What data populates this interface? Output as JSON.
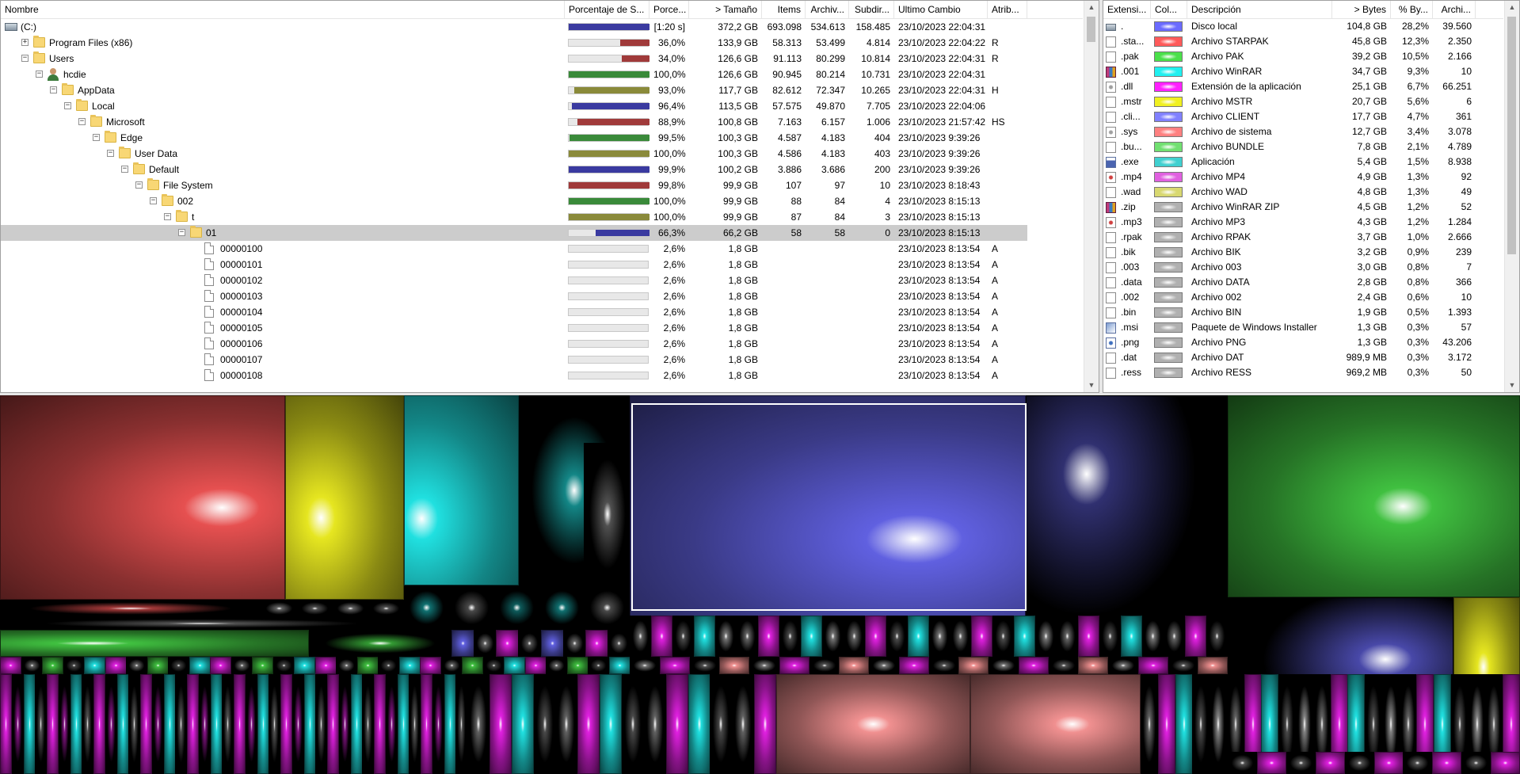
{
  "tree": {
    "columns": [
      "Nombre",
      "Porcentaje de S...",
      "Porce...",
      "> Tamaño",
      "Items",
      "Archiv...",
      "Subdir...",
      "Ultimo Cambio",
      "Atrib..."
    ],
    "rows": [
      {
        "level": 0,
        "icon": "drive",
        "expander": "",
        "name": "(C:)",
        "bar": 1.0,
        "bar_color": "#3a3aa0",
        "pct": "[1:20 s]",
        "size": "372,2 GB",
        "items": "693.098",
        "files": "534.613",
        "subdirs": "158.485",
        "modified": "23/10/2023  22:04:31",
        "attr": ""
      },
      {
        "level": 1,
        "icon": "folder",
        "expander": "+",
        "name": "Program Files (x86)",
        "bar": 0.36,
        "bar_color": "#a03a3a",
        "pct": "36,0%",
        "size": "133,9 GB",
        "items": "58.313",
        "files": "53.499",
        "subdirs": "4.814",
        "modified": "23/10/2023  22:04:22",
        "attr": "R"
      },
      {
        "level": 1,
        "icon": "folder",
        "expander": "−",
        "name": "Users",
        "bar": 0.34,
        "bar_color": "#a03a3a",
        "pct": "34,0%",
        "size": "126,6 GB",
        "items": "91.113",
        "files": "80.299",
        "subdirs": "10.814",
        "modified": "23/10/2023  22:04:31",
        "attr": "R"
      },
      {
        "level": 2,
        "icon": "user",
        "expander": "−",
        "name": "hcdie",
        "bar": 1.0,
        "bar_color": "#3a8a3a",
        "pct": "100,0%",
        "size": "126,6 GB",
        "items": "90.945",
        "files": "80.214",
        "subdirs": "10.731",
        "modified": "23/10/2023  22:04:31",
        "attr": ""
      },
      {
        "level": 3,
        "icon": "folder",
        "expander": "−",
        "name": "AppData",
        "bar": 0.93,
        "bar_color": "#8a8a3a",
        "pct": "93,0%",
        "size": "117,7 GB",
        "items": "82.612",
        "files": "72.347",
        "subdirs": "10.265",
        "modified": "23/10/2023  22:04:31",
        "attr": "H"
      },
      {
        "level": 4,
        "icon": "folder",
        "expander": "−",
        "name": "Local",
        "bar": 0.964,
        "bar_color": "#3a3aa0",
        "pct": "96,4%",
        "size": "113,5 GB",
        "items": "57.575",
        "files": "49.870",
        "subdirs": "7.705",
        "modified": "23/10/2023  22:04:06",
        "attr": ""
      },
      {
        "level": 5,
        "icon": "folder",
        "expander": "−",
        "name": "Microsoft",
        "bar": 0.889,
        "bar_color": "#a03a3a",
        "pct": "88,9%",
        "size": "100,8 GB",
        "items": "7.163",
        "files": "6.157",
        "subdirs": "1.006",
        "modified": "23/10/2023  21:57:42",
        "attr": "HS"
      },
      {
        "level": 6,
        "icon": "folder",
        "expander": "−",
        "name": "Edge",
        "bar": 0.995,
        "bar_color": "#3a8a3a",
        "pct": "99,5%",
        "size": "100,3 GB",
        "items": "4.587",
        "files": "4.183",
        "subdirs": "404",
        "modified": "23/10/2023  9:39:26",
        "attr": ""
      },
      {
        "level": 7,
        "icon": "folder",
        "expander": "−",
        "name": "User Data",
        "bar": 1.0,
        "bar_color": "#8a8a3a",
        "pct": "100,0%",
        "size": "100,3 GB",
        "items": "4.586",
        "files": "4.183",
        "subdirs": "403",
        "modified": "23/10/2023  9:39:26",
        "attr": ""
      },
      {
        "level": 8,
        "icon": "folder",
        "expander": "−",
        "name": "Default",
        "bar": 0.999,
        "bar_color": "#3a3aa0",
        "pct": "99,9%",
        "size": "100,2 GB",
        "items": "3.886",
        "files": "3.686",
        "subdirs": "200",
        "modified": "23/10/2023  9:39:26",
        "attr": ""
      },
      {
        "level": 9,
        "icon": "folder",
        "expander": "−",
        "name": "File System",
        "bar": 0.998,
        "bar_color": "#a03a3a",
        "pct": "99,8%",
        "size": "99,9 GB",
        "items": "107",
        "files": "97",
        "subdirs": "10",
        "modified": "23/10/2023  8:18:43",
        "attr": ""
      },
      {
        "level": 10,
        "icon": "folder",
        "expander": "−",
        "name": "002",
        "bar": 1.0,
        "bar_color": "#3a8a3a",
        "pct": "100,0%",
        "size": "99,9 GB",
        "items": "88",
        "files": "84",
        "subdirs": "4",
        "modified": "23/10/2023  8:15:13",
        "attr": ""
      },
      {
        "level": 11,
        "icon": "folder",
        "expander": "−",
        "name": "t",
        "bar": 1.0,
        "bar_color": "#8a8a3a",
        "pct": "100,0%",
        "size": "99,9 GB",
        "items": "87",
        "files": "84",
        "subdirs": "3",
        "modified": "23/10/2023  8:15:13",
        "attr": ""
      },
      {
        "level": 12,
        "icon": "folder",
        "expander": "−",
        "name": "01",
        "bar": 0.663,
        "bar_color": "#3a3aa0",
        "pct": "66,3%",
        "size": "66,2 GB",
        "items": "58",
        "files": "58",
        "subdirs": "0",
        "modified": "23/10/2023  8:15:13",
        "attr": "",
        "selected": true
      },
      {
        "level": 13,
        "icon": "file",
        "expander": "",
        "name": "00000100",
        "bar": 0.026,
        "bar_color": "#c0c0c0",
        "pct": "2,6%",
        "size": "1,8 GB",
        "items": "",
        "files": "",
        "subdirs": "",
        "modified": "23/10/2023  8:13:54",
        "attr": "A"
      },
      {
        "level": 13,
        "icon": "file",
        "expander": "",
        "name": "00000101",
        "bar": 0.026,
        "bar_color": "#c0c0c0",
        "pct": "2,6%",
        "size": "1,8 GB",
        "items": "",
        "files": "",
        "subdirs": "",
        "modified": "23/10/2023  8:13:54",
        "attr": "A"
      },
      {
        "level": 13,
        "icon": "file",
        "expander": "",
        "name": "00000102",
        "bar": 0.026,
        "bar_color": "#c0c0c0",
        "pct": "2,6%",
        "size": "1,8 GB",
        "items": "",
        "files": "",
        "subdirs": "",
        "modified": "23/10/2023  8:13:54",
        "attr": "A"
      },
      {
        "level": 13,
        "icon": "file",
        "expander": "",
        "name": "00000103",
        "bar": 0.026,
        "bar_color": "#c0c0c0",
        "pct": "2,6%",
        "size": "1,8 GB",
        "items": "",
        "files": "",
        "subdirs": "",
        "modified": "23/10/2023  8:13:54",
        "attr": "A"
      },
      {
        "level": 13,
        "icon": "file",
        "expander": "",
        "name": "00000104",
        "bar": 0.026,
        "bar_color": "#c0c0c0",
        "pct": "2,6%",
        "size": "1,8 GB",
        "items": "",
        "files": "",
        "subdirs": "",
        "modified": "23/10/2023  8:13:54",
        "attr": "A"
      },
      {
        "level": 13,
        "icon": "file",
        "expander": "",
        "name": "00000105",
        "bar": 0.026,
        "bar_color": "#c0c0c0",
        "pct": "2,6%",
        "size": "1,8 GB",
        "items": "",
        "files": "",
        "subdirs": "",
        "modified": "23/10/2023  8:13:54",
        "attr": "A"
      },
      {
        "level": 13,
        "icon": "file",
        "expander": "",
        "name": "00000106",
        "bar": 0.026,
        "bar_color": "#c0c0c0",
        "pct": "2,6%",
        "size": "1,8 GB",
        "items": "",
        "files": "",
        "subdirs": "",
        "modified": "23/10/2023  8:13:54",
        "attr": "A"
      },
      {
        "level": 13,
        "icon": "file",
        "expander": "",
        "name": "00000107",
        "bar": 0.026,
        "bar_color": "#c0c0c0",
        "pct": "2,6%",
        "size": "1,8 GB",
        "items": "",
        "files": "",
        "subdirs": "",
        "modified": "23/10/2023  8:13:54",
        "attr": "A"
      },
      {
        "level": 13,
        "icon": "file",
        "expander": "",
        "name": "00000108",
        "bar": 0.026,
        "bar_color": "#c0c0c0",
        "pct": "2,6%",
        "size": "1,8 GB",
        "items": "",
        "files": "",
        "subdirs": "",
        "modified": "23/10/2023  8:13:54",
        "attr": "A"
      }
    ]
  },
  "extensions": {
    "columns": [
      "Extensi...",
      "Col...",
      "Descripción",
      "> Bytes",
      "% By...",
      "Archi..."
    ],
    "rows": [
      {
        "icon": "drive",
        "ext": ".",
        "color": "#6a6aff",
        "desc": "Disco local",
        "bytes": "104,8 GB",
        "pct": "28,2%",
        "files": "39.560"
      },
      {
        "icon": "doc",
        "ext": ".sta...",
        "color": "#ff5a5a",
        "desc": "Archivo STARPAK",
        "bytes": "45,8 GB",
        "pct": "12,3%",
        "files": "2.350"
      },
      {
        "icon": "doc",
        "ext": ".pak",
        "color": "#4ae04a",
        "desc": "Archivo PAK",
        "bytes": "39,2 GB",
        "pct": "10,5%",
        "files": "2.166"
      },
      {
        "icon": "winrar",
        "ext": ".001",
        "color": "#20f0f0",
        "desc": "Archivo WinRAR",
        "bytes": "34,7 GB",
        "pct": "9,3%",
        "files": "10"
      },
      {
        "icon": "gear",
        "ext": ".dll",
        "color": "#ff20ff",
        "desc": "Extensión de la aplicación",
        "bytes": "25,1 GB",
        "pct": "6,7%",
        "files": "66.251"
      },
      {
        "icon": "doc",
        "ext": ".mstr",
        "color": "#f0f020",
        "desc": "Archivo MSTR",
        "bytes": "20,7 GB",
        "pct": "5,6%",
        "files": "6"
      },
      {
        "icon": "doc",
        "ext": ".cli...",
        "color": "#8080ff",
        "desc": "Archivo CLIENT",
        "bytes": "17,7 GB",
        "pct": "4,7%",
        "files": "361"
      },
      {
        "icon": "gear",
        "ext": ".sys",
        "color": "#ff8080",
        "desc": "Archivo de sistema",
        "bytes": "12,7 GB",
        "pct": "3,4%",
        "files": "3.078"
      },
      {
        "icon": "doc",
        "ext": ".bu...",
        "color": "#70e070",
        "desc": "Archivo BUNDLE",
        "bytes": "7,8 GB",
        "pct": "2,1%",
        "files": "4.789"
      },
      {
        "icon": "app",
        "ext": ".exe",
        "color": "#40d0d0",
        "desc": "Aplicación",
        "bytes": "5,4 GB",
        "pct": "1,5%",
        "files": "8.938"
      },
      {
        "icon": "media",
        "ext": ".mp4",
        "color": "#e060e0",
        "desc": "Archivo MP4",
        "bytes": "4,9 GB",
        "pct": "1,3%",
        "files": "92"
      },
      {
        "icon": "doc",
        "ext": ".wad",
        "color": "#d8d870",
        "desc": "Archivo WAD",
        "bytes": "4,8 GB",
        "pct": "1,3%",
        "files": "49"
      },
      {
        "icon": "winrar",
        "ext": ".zip",
        "color": "#b0b0b0",
        "desc": "Archivo WinRAR ZIP",
        "bytes": "4,5 GB",
        "pct": "1,2%",
        "files": "52"
      },
      {
        "icon": "media",
        "ext": ".mp3",
        "color": "#b0b0b0",
        "desc": "Archivo MP3",
        "bytes": "4,3 GB",
        "pct": "1,2%",
        "files": "1.284"
      },
      {
        "icon": "doc",
        "ext": ".rpak",
        "color": "#b0b0b0",
        "desc": "Archivo RPAK",
        "bytes": "3,7 GB",
        "pct": "1,0%",
        "files": "2.666"
      },
      {
        "icon": "doc",
        "ext": ".bik",
        "color": "#b0b0b0",
        "desc": "Archivo BIK",
        "bytes": "3,2 GB",
        "pct": "0,9%",
        "files": "239"
      },
      {
        "icon": "doc",
        "ext": ".003",
        "color": "#b0b0b0",
        "desc": "Archivo 003",
        "bytes": "3,0 GB",
        "pct": "0,8%",
        "files": "7"
      },
      {
        "icon": "doc",
        "ext": ".data",
        "color": "#b0b0b0",
        "desc": "Archivo DATA",
        "bytes": "2,8 GB",
        "pct": "0,8%",
        "files": "366"
      },
      {
        "icon": "doc",
        "ext": ".002",
        "color": "#b0b0b0",
        "desc": "Archivo 002",
        "bytes": "2,4 GB",
        "pct": "0,6%",
        "files": "10"
      },
      {
        "icon": "doc",
        "ext": ".bin",
        "color": "#b0b0b0",
        "desc": "Archivo BIN",
        "bytes": "1,9 GB",
        "pct": "0,5%",
        "files": "1.393"
      },
      {
        "icon": "msi",
        "ext": ".msi",
        "color": "#b0b0b0",
        "desc": "Paquete de Windows Installer",
        "bytes": "1,3 GB",
        "pct": "0,3%",
        "files": "57"
      },
      {
        "icon": "png",
        "ext": ".png",
        "color": "#b0b0b0",
        "desc": "Archivo PNG",
        "bytes": "1,3 GB",
        "pct": "0,3%",
        "files": "43.206"
      },
      {
        "icon": "doc",
        "ext": ".dat",
        "color": "#b0b0b0",
        "desc": "Archivo DAT",
        "bytes": "989,9 MB",
        "pct": "0,3%",
        "files": "3.172"
      },
      {
        "icon": "doc",
        "ext": ".ress",
        "color": "#b0b0b0",
        "desc": "Archivo RESS",
        "bytes": "969,2 MB",
        "pct": "0,3%",
        "files": "50"
      }
    ]
  },
  "treemap": {
    "colors": {
      "red": "#e65050",
      "yellow": "#e6e620",
      "cyan": "#20e0e0",
      "blue": "#6060e0",
      "green": "#40c040",
      "magenta": "#e020e0",
      "gray": "#a0a0a0",
      "pink": "#f09090"
    }
  }
}
